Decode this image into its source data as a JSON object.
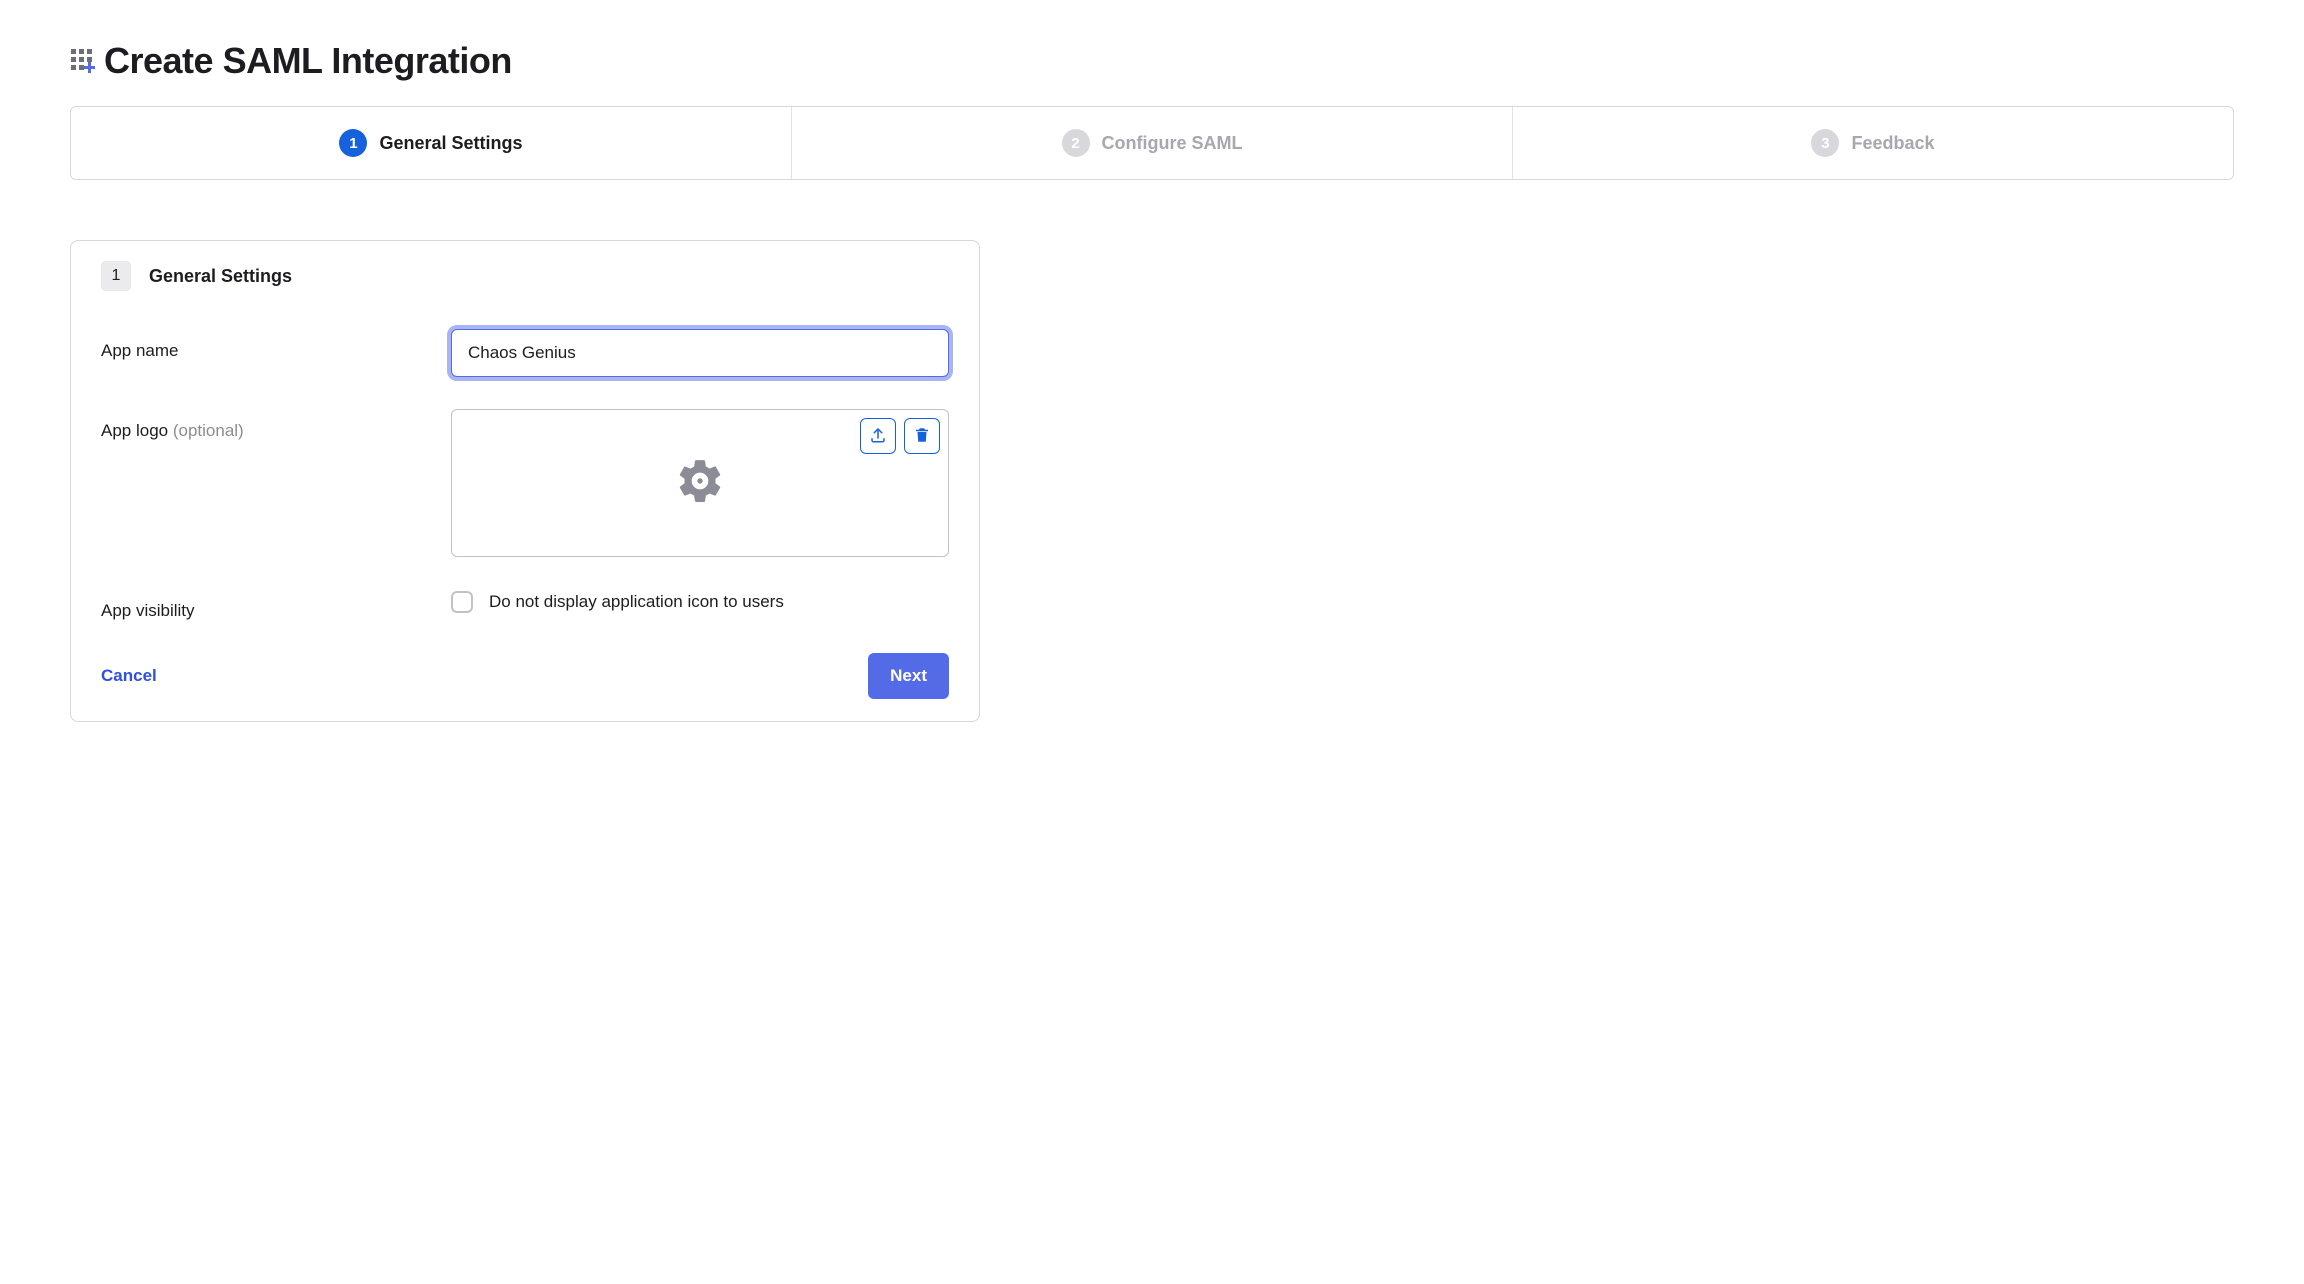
{
  "page": {
    "title": "Create SAML Integration"
  },
  "stepper": {
    "steps": [
      {
        "num": "1",
        "label": "General Settings",
        "active": true
      },
      {
        "num": "2",
        "label": "Configure SAML",
        "active": false
      },
      {
        "num": "3",
        "label": "Feedback",
        "active": false
      }
    ]
  },
  "panel": {
    "number": "1",
    "title": "General Settings",
    "app_name": {
      "label": "App name",
      "value": "Chaos Genius"
    },
    "app_logo": {
      "label": "App logo ",
      "optional": "(optional)"
    },
    "app_visibility": {
      "label": "App visibility",
      "checkbox_label": "Do not display application icon to users",
      "checked": false
    },
    "cancel": "Cancel",
    "next": "Next"
  }
}
